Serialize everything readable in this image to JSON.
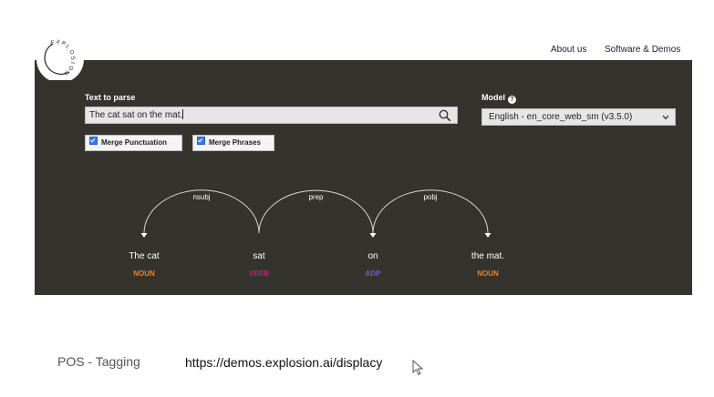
{
  "brand": {
    "logo_text": "EXPLOSION"
  },
  "nav": {
    "about": "About us",
    "software": "Software & Demos"
  },
  "form": {
    "text_label": "Text to parse",
    "text_value": "The cat sat on the mat.",
    "model_label": "Model",
    "model_value": "English - en_core_web_sm (v3.5.0)",
    "merge_punctuation": {
      "label": "Merge Punctuation",
      "checked": true
    },
    "merge_phrases": {
      "label": "Merge Phrases",
      "checked": true
    }
  },
  "parse": {
    "tokens": [
      {
        "text": "The cat",
        "tag": "NOUN",
        "color": "#e8822a"
      },
      {
        "text": "sat",
        "tag": "VERB",
        "color": "#c0237e"
      },
      {
        "text": "on",
        "tag": "ADP",
        "color": "#6a5ed6"
      },
      {
        "text": "the mat.",
        "tag": "NOUN",
        "color": "#e8822a"
      }
    ],
    "arcs": [
      {
        "label": "nsubj",
        "head": 1,
        "dep": 0
      },
      {
        "label": "prep",
        "head": 1,
        "dep": 2
      },
      {
        "label": "pobj",
        "head": 2,
        "dep": 3
      }
    ]
  },
  "footer": {
    "label": "POS - Tagging",
    "url": "https://demos.explosion.ai/displacy"
  },
  "colors": {
    "panel": "#35332e",
    "noun": "#e8822a",
    "verb": "#c0237e",
    "adp": "#6a5ed6"
  }
}
